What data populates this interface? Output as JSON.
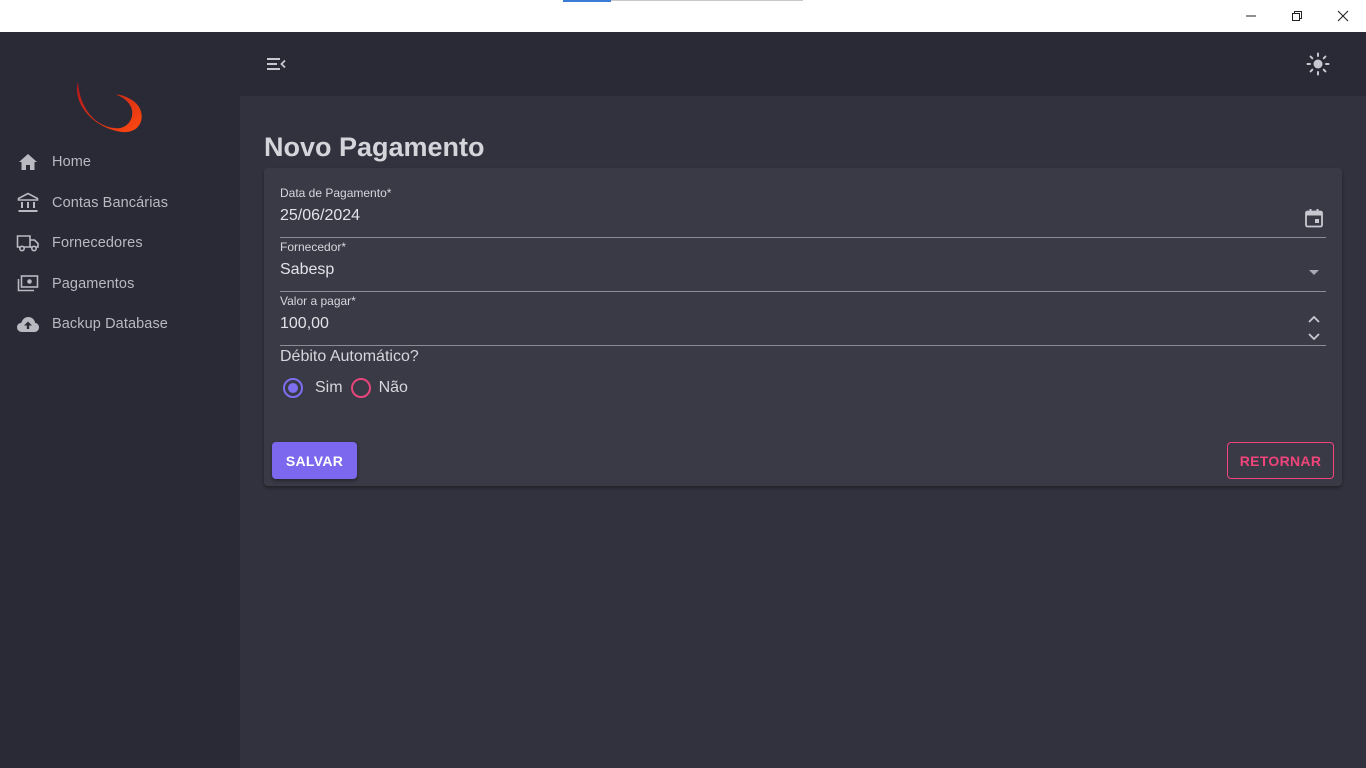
{
  "window": {
    "controls": [
      "minimize-icon",
      "restore-icon",
      "close-icon"
    ]
  },
  "sidebar": {
    "items": [
      {
        "label": "Home",
        "icon": "home-icon"
      },
      {
        "label": "Contas Bancárias",
        "icon": "bank-icon"
      },
      {
        "label": "Fornecedores",
        "icon": "truck-icon"
      },
      {
        "label": "Pagamentos",
        "icon": "payments-icon"
      },
      {
        "label": "Backup Database",
        "icon": "cloud-upload-icon"
      }
    ]
  },
  "appbar": {
    "menu_icon": "menu-open-icon",
    "theme_icon": "sun-icon"
  },
  "page": {
    "title": "Novo Pagamento"
  },
  "form": {
    "date": {
      "label": "Data de Pagamento*",
      "value": "25/06/2024",
      "icon": "calendar-icon"
    },
    "supplier": {
      "label": "Fornecedor*",
      "value": "Sabesp",
      "icon": "dropdown-arrow-icon"
    },
    "amount": {
      "label": "Valor a pagar*",
      "value": "100,00",
      "icon": "stepper-icon"
    },
    "auto_debit": {
      "label": "Débito Automático?",
      "options": [
        "Sim",
        "Não"
      ],
      "selected": "Sim"
    },
    "save_label": "SALVAR",
    "return_label": "RETORNAR"
  },
  "colors": {
    "primary": "#7b68ee",
    "secondary": "#f0447a",
    "background": "#32323e",
    "sidebar": "#292a35",
    "card": "#393a46"
  }
}
